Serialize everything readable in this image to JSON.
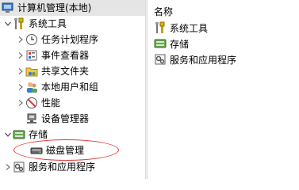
{
  "tree": {
    "root": "计算机管理(本地)",
    "system_tools": "系统工具",
    "task_scheduler": "任务计划程序",
    "event_viewer": "事件查看器",
    "shared_folders": "共享文件夹",
    "local_users_groups": "本地用户和组",
    "performance": "性能",
    "device_manager": "设备管理器",
    "storage": "存储",
    "disk_management": "磁盘管理",
    "services_apps": "服务和应用程序"
  },
  "list": {
    "column_name": "名称",
    "items": [
      "系统工具",
      "存储",
      "服务和应用程序"
    ]
  },
  "icons": {
    "root": "computer-management-icon",
    "system_tools": "tools-icon",
    "task_scheduler": "clock-icon",
    "event_viewer": "event-log-icon",
    "shared_folders": "shared-folder-icon",
    "local_users_groups": "users-icon",
    "performance": "performance-icon",
    "device_manager": "device-manager-icon",
    "storage": "storage-icon",
    "disk_management": "disk-icon",
    "services_apps": "services-icon"
  },
  "colors": {
    "annotation": "#e23b3b",
    "selection": "#e5e5e5"
  }
}
